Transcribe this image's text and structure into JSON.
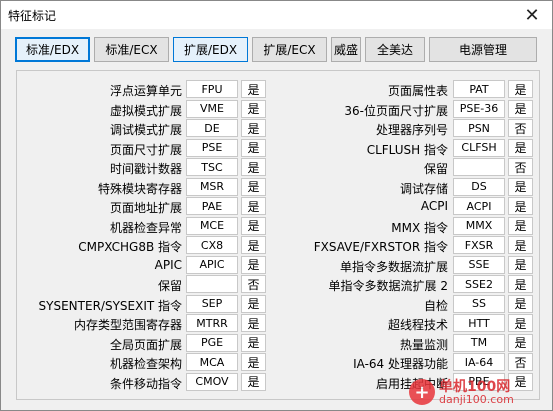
{
  "window": {
    "title": "特征标记",
    "close_glyph": "✕"
  },
  "tabs": [
    {
      "label": "标准/EDX",
      "state": "active"
    },
    {
      "label": "标准/ECX",
      "state": "normal"
    },
    {
      "label": "扩展/EDX",
      "state": "highlight"
    },
    {
      "label": "扩展/ECX",
      "state": "normal"
    },
    {
      "label": "威盛",
      "state": "normal"
    },
    {
      "label": "全美达",
      "state": "normal"
    },
    {
      "label": "电源管理",
      "state": "normal"
    }
  ],
  "left_features": [
    {
      "label": "浮点运算单元",
      "code": "FPU",
      "value": "是"
    },
    {
      "label": "虚拟模式扩展",
      "code": "VME",
      "value": "是"
    },
    {
      "label": "调试模式扩展",
      "code": "DE",
      "value": "是"
    },
    {
      "label": "页面尺寸扩展",
      "code": "PSE",
      "value": "是"
    },
    {
      "label": "时间戳计数器",
      "code": "TSC",
      "value": "是"
    },
    {
      "label": "特殊模块寄存器",
      "code": "MSR",
      "value": "是"
    },
    {
      "label": "页面地址扩展",
      "code": "PAE",
      "value": "是"
    },
    {
      "label": "机器检查异常",
      "code": "MCE",
      "value": "是"
    },
    {
      "label": "CMPXCHG8B 指令",
      "code": "CX8",
      "value": "是"
    },
    {
      "label": "APIC",
      "code": "APIC",
      "value": "是"
    },
    {
      "label": "保留",
      "code": "",
      "value": "否"
    },
    {
      "label": "SYSENTER/SYSEXIT 指令",
      "code": "SEP",
      "value": "是"
    },
    {
      "label": "内存类型范围寄存器",
      "code": "MTRR",
      "value": "是"
    },
    {
      "label": "全局页面扩展",
      "code": "PGE",
      "value": "是"
    },
    {
      "label": "机器检查架构",
      "code": "MCA",
      "value": "是"
    },
    {
      "label": "条件移动指令",
      "code": "CMOV",
      "value": "是"
    }
  ],
  "right_features": [
    {
      "label": "页面属性表",
      "code": "PAT",
      "value": "是"
    },
    {
      "label": "36-位页面尺寸扩展",
      "code": "PSE-36",
      "value": "是"
    },
    {
      "label": "处理器序列号",
      "code": "PSN",
      "value": "否"
    },
    {
      "label": "CLFLUSH 指令",
      "code": "CLFSH",
      "value": "是"
    },
    {
      "label": "保留",
      "code": "",
      "value": "否"
    },
    {
      "label": "调试存储",
      "code": "DS",
      "value": "是"
    },
    {
      "label": "ACPI",
      "code": "ACPI",
      "value": "是"
    },
    {
      "label": "MMX 指令",
      "code": "MMX",
      "value": "是"
    },
    {
      "label": "FXSAVE/FXRSTOR 指令",
      "code": "FXSR",
      "value": "是"
    },
    {
      "label": "单指令多数据流扩展",
      "code": "SSE",
      "value": "是"
    },
    {
      "label": "单指令多数据流扩展 2",
      "code": "SSE2",
      "value": "是"
    },
    {
      "label": "自检",
      "code": "SS",
      "value": "是"
    },
    {
      "label": "超线程技术",
      "code": "HTT",
      "value": "是"
    },
    {
      "label": "热量监测",
      "code": "TM",
      "value": "是"
    },
    {
      "label": "IA-64 处理器功能",
      "code": "IA-64",
      "value": "否"
    },
    {
      "label": "启用挂起中断",
      "code": "PBE",
      "value": "是"
    }
  ],
  "watermark": {
    "main": "单机100网",
    "sub": "danji100.com",
    "glyph": "+"
  }
}
